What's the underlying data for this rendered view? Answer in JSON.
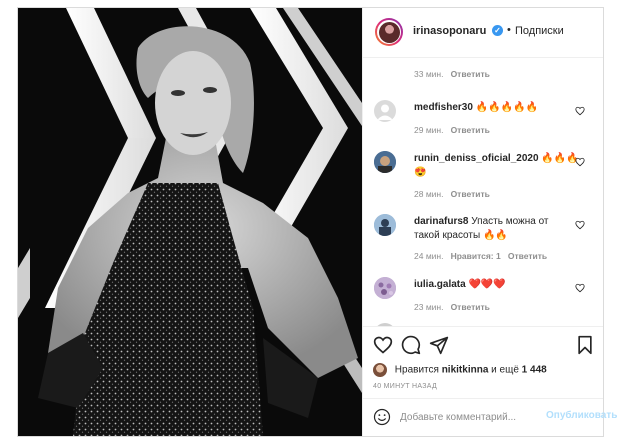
{
  "header": {
    "username": "irinasoponaru",
    "separator": "•",
    "follow_state": "Подписки",
    "verified_glyph": "✓"
  },
  "comments": [
    {
      "user": "",
      "text": "",
      "time": "33 мин.",
      "likes": "",
      "reply": "Ответить"
    },
    {
      "user": "medfisher30",
      "text": "🔥🔥🔥🔥🔥",
      "time": "29 мин.",
      "likes": "",
      "reply": "Ответить"
    },
    {
      "user": "runin_deniss_oficial_2020",
      "text": "🔥🔥🔥",
      "text2": "😍",
      "time": "28 мин.",
      "likes": "",
      "reply": "Ответить"
    },
    {
      "user": "darinafurs8",
      "text": "Упасть можна от",
      "text2": "такой красоты 🔥🔥",
      "time": "24 мин.",
      "likes": "Нравится: 1",
      "reply": "Ответить"
    },
    {
      "user": "iulia.galata",
      "text": "❤️❤️❤️",
      "time": "23 мин.",
      "likes": "",
      "reply": "Ответить"
    }
  ],
  "actions": {
    "like_icon": "heart-outline-icon",
    "comment_icon": "comment-icon",
    "share_icon": "paper-plane-icon",
    "save_icon": "bookmark-icon"
  },
  "likes": {
    "prefix": "Нравится",
    "user": "nikitkinna",
    "middle": "и ещё",
    "count": "1 448"
  },
  "time_ago": "40 МИНУТ НАЗАД",
  "add_comment": {
    "placeholder": "Добавьте комментарий...",
    "publish": "Опубликовать"
  },
  "colors": {
    "verified": "#3897f0",
    "publish_disabled": "#b2dffc",
    "muted": "#8e8e8e"
  }
}
